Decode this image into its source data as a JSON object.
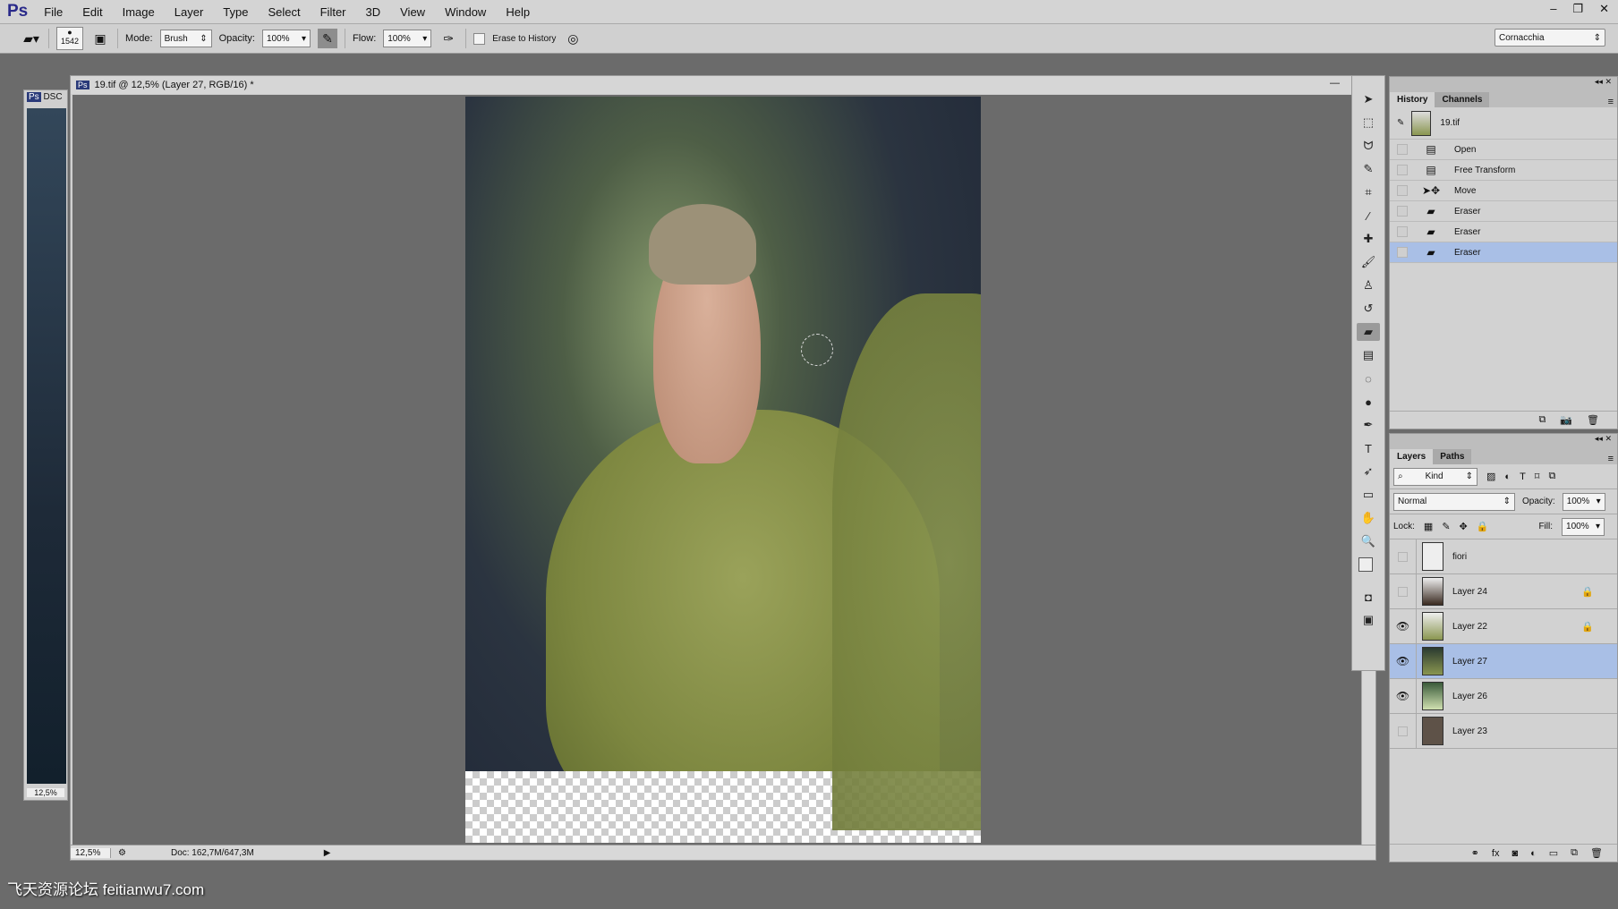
{
  "app": {
    "logo": "Ps",
    "menu": [
      "File",
      "Edit",
      "Image",
      "Layer",
      "Type",
      "Select",
      "Filter",
      "3D",
      "View",
      "Window",
      "Help"
    ]
  },
  "options": {
    "brush_size": "1542",
    "mode_label": "Mode:",
    "mode_value": "Brush",
    "opacity_label": "Opacity:",
    "opacity_value": "100%",
    "flow_label": "Flow:",
    "flow_value": "100%",
    "erase_to_history": "Erase to History",
    "workspace": "Cornacchia"
  },
  "side_doc": {
    "title": "DSC",
    "zoom": "12,5%"
  },
  "document": {
    "title": "19.tif @ 12,5% (Layer 27, RGB/16) *",
    "zoom": "12,5%",
    "doc_size": "Doc: 162,7M/647,3M"
  },
  "history": {
    "tabs": [
      "History",
      "Channels"
    ],
    "snapshot": "19.tif",
    "items": [
      {
        "label": "Open",
        "icon": "document-icon"
      },
      {
        "label": "Free Transform",
        "icon": "document-icon"
      },
      {
        "label": "Move",
        "icon": "move-icon"
      },
      {
        "label": "Eraser",
        "icon": "eraser-icon"
      },
      {
        "label": "Eraser",
        "icon": "eraser-icon"
      },
      {
        "label": "Eraser",
        "icon": "eraser-icon",
        "selected": true
      }
    ]
  },
  "layers": {
    "tabs": [
      "Layers",
      "Paths"
    ],
    "filter": "Kind",
    "blend": "Normal",
    "opacity_label": "Opacity:",
    "opacity": "100%",
    "lock_label": "Lock:",
    "fill_label": "Fill:",
    "fill": "100%",
    "items": [
      {
        "name": "fiori",
        "visible": false,
        "locked": false
      },
      {
        "name": "Layer 24",
        "visible": false,
        "locked": true
      },
      {
        "name": "Layer 22",
        "visible": true,
        "locked": true
      },
      {
        "name": "Layer 27",
        "visible": true,
        "locked": false,
        "selected": true
      },
      {
        "name": "Layer 26",
        "visible": true,
        "locked": false
      },
      {
        "name": "Layer 23",
        "visible": false,
        "locked": false
      }
    ]
  },
  "watermark": "飞天资源论坛 feitianwu7.com",
  "colors": {
    "selection": "#a9bfe6",
    "workspace": "#6b6b6b"
  }
}
